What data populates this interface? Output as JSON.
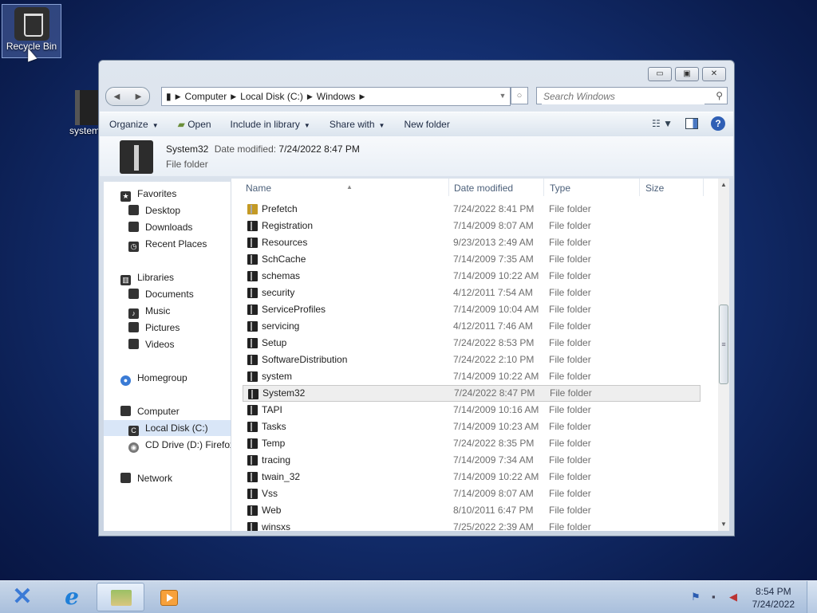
{
  "desktop": {
    "icons": [
      {
        "label": "Recycle Bin"
      },
      {
        "label": "system"
      }
    ]
  },
  "window": {
    "caption": {
      "minimize": "▭",
      "maximize": "▣",
      "close": "✕"
    },
    "address": {
      "segments": [
        "Computer",
        "Local Disk (C:)",
        "Windows"
      ]
    },
    "search": {
      "placeholder": "Search Windows"
    },
    "toolbar": {
      "organize": "Organize",
      "open": "Open",
      "include_in_library": "Include in library",
      "share_with": "Share with",
      "new_folder": "New folder"
    },
    "details": {
      "name": "System32",
      "date_modified_label": "Date modified:",
      "date_modified": "7/24/2022 8:47 PM",
      "type": "File folder"
    },
    "nav": {
      "favorites": "Favorites",
      "desktop": "Desktop",
      "downloads": "Downloads",
      "recent_places": "Recent Places",
      "libraries": "Libraries",
      "documents": "Documents",
      "music": "Music",
      "pictures": "Pictures",
      "videos": "Videos",
      "homegroup": "Homegroup",
      "computer": "Computer",
      "local_disk": "Local Disk (C:)",
      "cd_drive": "CD Drive (D:) Firefox",
      "network": "Network"
    },
    "columns": {
      "name": "Name",
      "date_modified": "Date modified",
      "type": "Type",
      "size": "Size"
    },
    "rows": [
      {
        "name": "Prefetch",
        "date": "7/24/2022 8:41 PM",
        "type": "File folder",
        "locked": true
      },
      {
        "name": "Registration",
        "date": "7/14/2009 8:07 AM",
        "type": "File folder"
      },
      {
        "name": "Resources",
        "date": "9/23/2013 2:49 AM",
        "type": "File folder"
      },
      {
        "name": "SchCache",
        "date": "7/14/2009 7:35 AM",
        "type": "File folder"
      },
      {
        "name": "schemas",
        "date": "7/14/2009 10:22 AM",
        "type": "File folder"
      },
      {
        "name": "security",
        "date": "4/12/2011 7:54 AM",
        "type": "File folder"
      },
      {
        "name": "ServiceProfiles",
        "date": "7/14/2009 10:04 AM",
        "type": "File folder"
      },
      {
        "name": "servicing",
        "date": "4/12/2011 7:46 AM",
        "type": "File folder"
      },
      {
        "name": "Setup",
        "date": "7/24/2022 8:53 PM",
        "type": "File folder"
      },
      {
        "name": "SoftwareDistribution",
        "date": "7/24/2022 2:10 PM",
        "type": "File folder"
      },
      {
        "name": "system",
        "date": "7/14/2009 10:22 AM",
        "type": "File folder"
      },
      {
        "name": "System32",
        "date": "7/24/2022 8:47 PM",
        "type": "File folder",
        "selected": true
      },
      {
        "name": "TAPI",
        "date": "7/14/2009 10:16 AM",
        "type": "File folder"
      },
      {
        "name": "Tasks",
        "date": "7/14/2009 10:23 AM",
        "type": "File folder"
      },
      {
        "name": "Temp",
        "date": "7/24/2022 8:35 PM",
        "type": "File folder"
      },
      {
        "name": "tracing",
        "date": "7/14/2009 7:34 AM",
        "type": "File folder"
      },
      {
        "name": "twain_32",
        "date": "7/14/2009 10:22 AM",
        "type": "File folder"
      },
      {
        "name": "Vss",
        "date": "7/14/2009 8:07 AM",
        "type": "File folder"
      },
      {
        "name": "Web",
        "date": "8/10/2011 6:47 PM",
        "type": "File folder"
      },
      {
        "name": "winsxs",
        "date": "7/25/2022 2:39 AM",
        "type": "File folder"
      }
    ]
  },
  "taskbar": {
    "clock_time": "8:54 PM",
    "clock_date": "7/24/2022"
  }
}
